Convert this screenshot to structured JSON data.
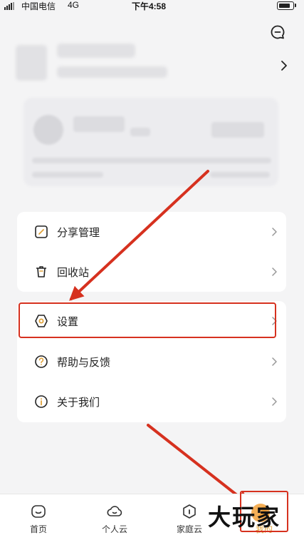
{
  "status_bar": {
    "carrier": "中国电信",
    "network": "4G",
    "time": "下午4:58"
  },
  "menu": {
    "group1": [
      {
        "label": "分享管理",
        "icon": "share-management-icon"
      },
      {
        "label": "回收站",
        "icon": "trash-icon"
      }
    ],
    "group2": [
      {
        "label": "设置",
        "icon": "settings-icon"
      },
      {
        "label": "帮助与反馈",
        "icon": "help-icon"
      },
      {
        "label": "关于我们",
        "icon": "info-icon"
      }
    ]
  },
  "tab_bar": {
    "tabs": [
      {
        "label": "首页",
        "icon": "home-tab-icon"
      },
      {
        "label": "个人云",
        "icon": "cloud-tab-icon"
      },
      {
        "label": "家庭云",
        "icon": "family-cloud-tab-icon"
      },
      {
        "label": "我的",
        "icon": "mine-tab-icon"
      }
    ],
    "active_index": 3
  },
  "watermark": {
    "text": "大玩家"
  },
  "colors": {
    "annotation_red": "#d6311f",
    "accent_orange": "#e0a23a",
    "background": "#f4f4f5"
  }
}
